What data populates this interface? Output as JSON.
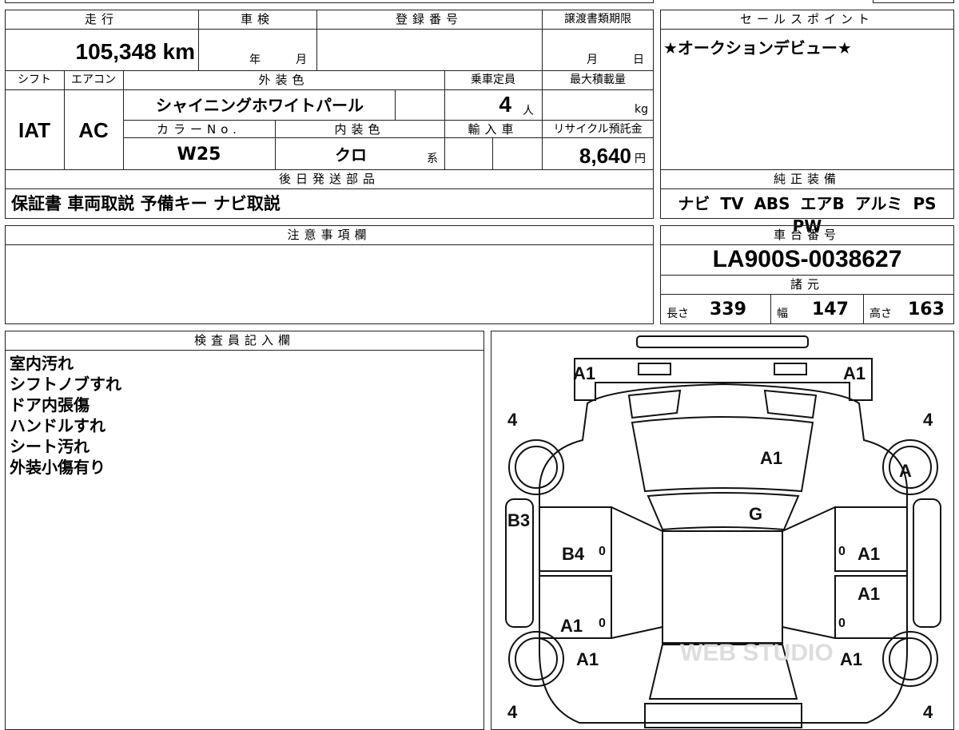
{
  "top_left": {
    "headers": {
      "mileage": "走行",
      "inspection": "車検",
      "registration": "登録番号",
      "transfer_deadline": "譲渡書類期限"
    },
    "mileage": "105,348 km",
    "inspection_year": "年",
    "inspection_month": "月",
    "transfer_month": "月",
    "transfer_day": "日"
  },
  "row2": {
    "headers": {
      "shift": "シフト",
      "aircon": "エアコン",
      "exterior_color": "外装色",
      "capacity": "乗車定員",
      "max_load": "最大積載量"
    },
    "shift": "IAT",
    "aircon": "AC",
    "exterior_color": "シャイニングホワイトパール",
    "capacity": "4",
    "capacity_unit": "人",
    "max_load_unit": "kg",
    "sub_headers": {
      "color_no": "カラーNo.",
      "interior_color": "内装色",
      "import": "輸入車",
      "recycle": "リサイクル預託金"
    },
    "color_no": "W25",
    "interior_color": "クロ",
    "interior_suffix": "系",
    "recycle_fee": "8,640",
    "recycle_unit": "円"
  },
  "later_parts": {
    "header": "後日発送部品",
    "value": "保証書 車両取説 予備キー ナビ取説"
  },
  "sales_point": {
    "header": "セールスポイント",
    "value": "★オークションデビュー★"
  },
  "genuine_equipment": {
    "header": "純正装備",
    "value": "ナビ TV ABS エアB アルミ PS PW"
  },
  "notes": {
    "header": "注意事項欄"
  },
  "chassis": {
    "header": "車台番号",
    "value": "LA900S-0038627"
  },
  "specs": {
    "header": "諸元",
    "length_label": "長さ",
    "length": "339",
    "width_label": "幅",
    "width": "147",
    "height_label": "高さ",
    "height": "163"
  },
  "inspector": {
    "header": "検査員記入欄",
    "items": [
      "室内汚れ",
      "シフトノブすれ",
      "ドア内張傷",
      "ハンドルすれ",
      "シート汚れ",
      "外装小傷有り"
    ]
  },
  "diagram": {
    "tire_tl": "4",
    "tire_tr": "4",
    "tire_bl": "4",
    "tire_br": "4",
    "front_left": "A1",
    "front_right": "A1",
    "hood": "A1",
    "wheel_fr": "A",
    "windshield": "G",
    "fender_l": "B3",
    "door_fl": "B4",
    "door_fr": "A1",
    "door_rr": "A1",
    "door_rl": "A1",
    "rear_l": "A1",
    "rear_r": "A1",
    "mark0": "0",
    "watermark": "WEB STUDIO"
  }
}
